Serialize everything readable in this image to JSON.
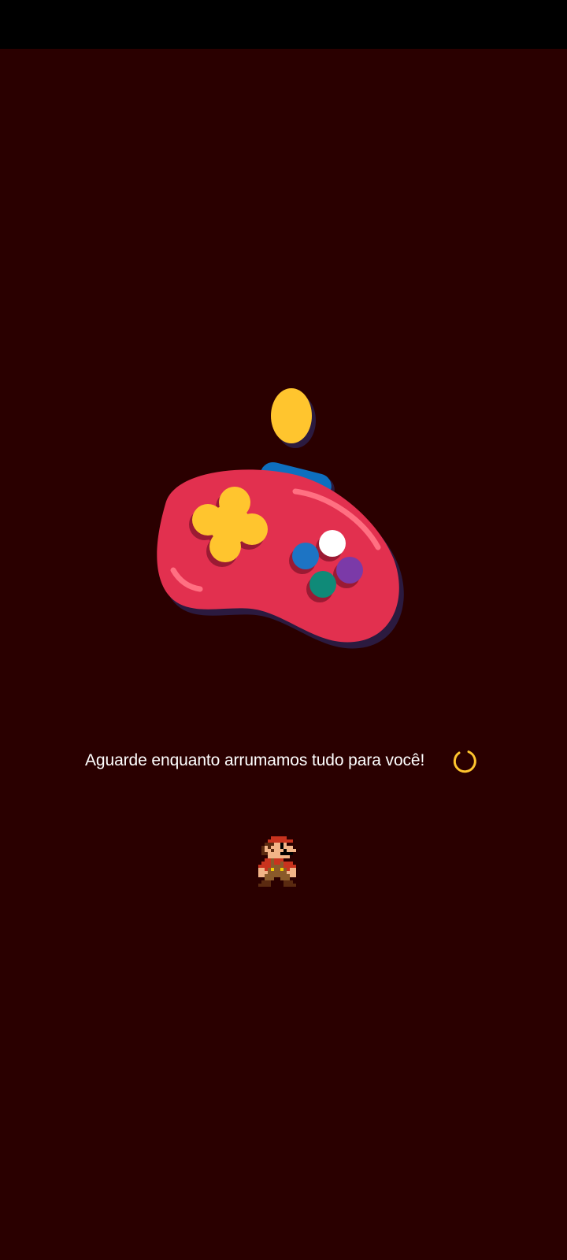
{
  "screen": {
    "background_color": "#2a0000",
    "status_bar_color": "#000000"
  },
  "illustration": {
    "name": "gamepad-illustration",
    "body_color": "#e2304f",
    "shadow_color": "#2b1a3f",
    "dpad_color": "#ffc52e",
    "bumper_color": "#0e6fbf",
    "coin_color": "#ffc52e",
    "button_colors": [
      "#ffffff",
      "#1d74c4",
      "#7b3aa8",
      "#0f8a78"
    ]
  },
  "loading": {
    "message": "Aguarde enquanto arrumamos tudo para você!",
    "spinner_color": "#ffc52e"
  },
  "sprite": {
    "name": "pixel-plumber-sprite"
  }
}
